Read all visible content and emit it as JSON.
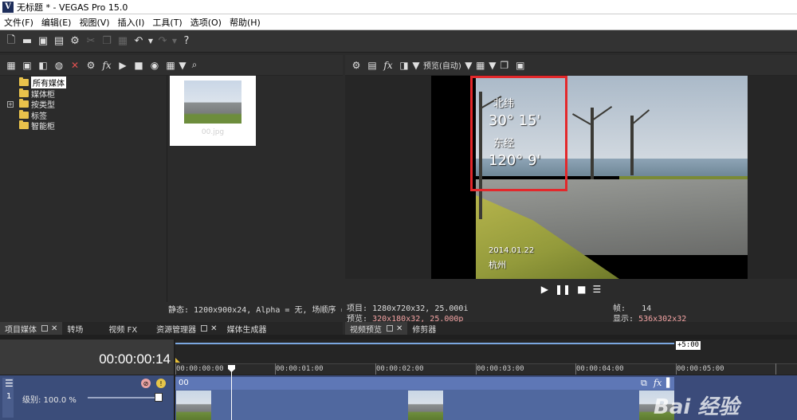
{
  "window": {
    "title": "无标题 * - VEGAS Pro 15.0",
    "app_icon_letter": "V"
  },
  "menu": [
    "文件(F)",
    "编辑(E)",
    "视图(V)",
    "插入(I)",
    "工具(T)",
    "选项(O)",
    "帮助(H)"
  ],
  "main_toolbar": {
    "icons": [
      "new-icon",
      "open-icon",
      "save-icon",
      "save-as-icon",
      "gear-icon",
      "cut-icon",
      "copy-icon",
      "paste-icon",
      "undo-icon",
      "redo-icon",
      "help-icon"
    ]
  },
  "media_panel": {
    "tree": [
      {
        "label": "所有媒体",
        "selected": true,
        "expander": false
      },
      {
        "label": "媒体柜",
        "selected": false,
        "expander": false
      },
      {
        "label": "按类型",
        "selected": false,
        "expander": true
      },
      {
        "label": "标签",
        "selected": false,
        "expander": false
      },
      {
        "label": "智能柜",
        "selected": false,
        "expander": false
      }
    ],
    "expander_symbol": "+",
    "thumbnail_name": "00.jpg",
    "status": "静态: 1200x900x24, Alpha = 无, 场顺序 = 无(逐"
  },
  "left_tabs": [
    {
      "label": "项目媒体",
      "active": true,
      "closable": true
    },
    {
      "label": "转场",
      "active": false,
      "closable": false
    },
    {
      "label": "视频 FX",
      "active": false,
      "closable": false
    },
    {
      "label": "资源管理器",
      "active": false,
      "closable": true
    },
    {
      "label": "媒体生成器",
      "active": false,
      "closable": false
    }
  ],
  "preview": {
    "toolbar_preview_label": "预览(自动)",
    "overlay": {
      "lat_label": "北纬",
      "lat_value": "30° 15'",
      "lon_label": "东经",
      "lon_value": "120° 9'",
      "date": "2014.01.22",
      "place": "杭州"
    },
    "transport_icons": [
      "play-icon",
      "pause-icon",
      "stop-icon",
      "menu-icon"
    ],
    "info": {
      "project_label": "项目:",
      "project_value": "1280x720x32, 25.000i",
      "preview_label": "预览:",
      "preview_value": "320x180x32, 25.000p",
      "frame_label": "帧:",
      "frame_value": "14",
      "display_label": "显示:",
      "display_value": "536x302x32"
    }
  },
  "right_tabs": [
    {
      "label": "视频预览",
      "active": true,
      "closable": true
    },
    {
      "label": "修剪器",
      "active": false,
      "closable": false
    }
  ],
  "timeline": {
    "timecode": "00:00:00:14",
    "end_marker": "+5:00",
    "ticks": [
      "00:00:00:00",
      "00:00:01:00",
      "00:00:02:00",
      "00:00:03:00",
      "00:00:04:00",
      "00:00:05:00"
    ],
    "track": {
      "number": "1",
      "level_label": "级别: 100.0 %",
      "clip_name": "00",
      "level_percent": 100
    }
  },
  "watermark": "Bai 经验"
}
